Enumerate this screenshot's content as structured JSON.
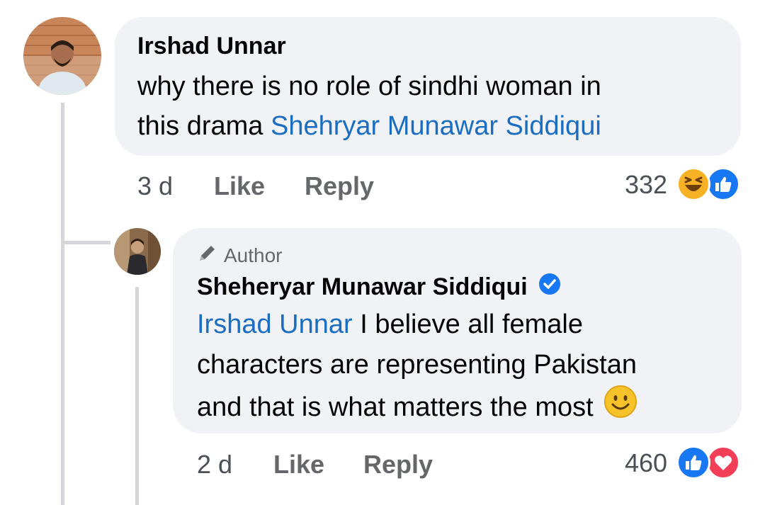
{
  "comments": [
    {
      "author": "Irshad Unnar",
      "text_line1": "why there is no role of sindhi woman in",
      "text_line2_prefix": "this  drama ",
      "text_line2_mention": "Shehryar Munawar Siddiqui",
      "time": "3 d",
      "like_label": "Like",
      "reply_label": "Reply",
      "reaction_count": "332",
      "reactions": [
        "haha-icon",
        "like-icon"
      ]
    },
    {
      "author_badge": "Author",
      "author": "Sheheryar Munawar Siddiqui",
      "verified": true,
      "text_line1_mention": "Irshad Unnar",
      "text_line1_rest": " I believe all female",
      "text_line2": "characters are representing Pakistan",
      "text_line3": "and that is what matters the most",
      "time": "2 d",
      "like_label": "Like",
      "reply_label": "Reply",
      "reaction_count": "460",
      "reactions": [
        "like-icon",
        "love-icon"
      ]
    }
  ],
  "colors": {
    "bubble": "#f0f2f5",
    "mention": "#1b6dc1",
    "like_blue": "#1877f2",
    "love_red": "#f33e58",
    "haha_yellow": "#f7b125"
  }
}
